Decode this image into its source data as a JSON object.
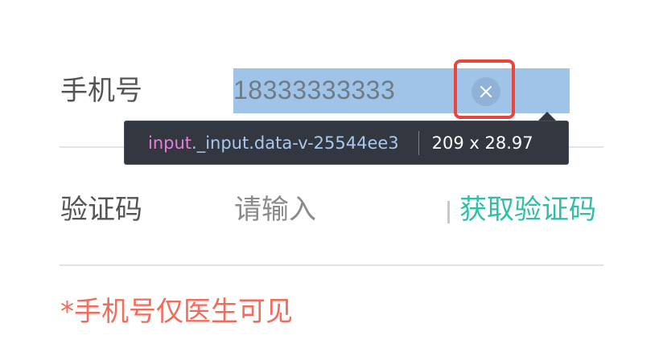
{
  "form": {
    "phone_label": "手机号",
    "phone_value": "18333333333",
    "code_label": "验证码",
    "code_placeholder": "请输入",
    "get_code_label": "获取验证码",
    "notice": "*手机号仅医生可见"
  },
  "inspector": {
    "selector_tag": "input",
    "selector_rest": "._input.data-v-25544ee3",
    "size": "209 x 28.97"
  },
  "icons": {
    "clear": "clear-icon"
  },
  "colors": {
    "accent": "#2fbfa8",
    "notice": "#f26b5b",
    "highlight_box": "#e8463a",
    "selection": "#a0c4e8"
  }
}
